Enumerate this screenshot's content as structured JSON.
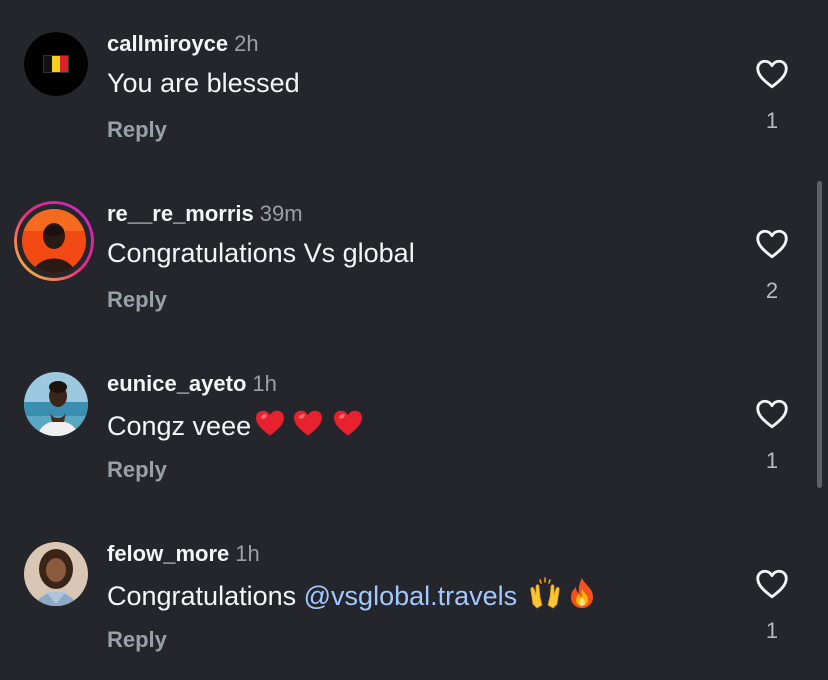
{
  "comments": [
    {
      "username": "callmiroyce",
      "time": "2h",
      "text": "You are blessed",
      "reply_label": "Reply",
      "likes": "1",
      "avatar": "belgium-flag-avatar"
    },
    {
      "username": "re__re_morris",
      "time": "39m",
      "text": "Congratulations Vs global",
      "reply_label": "Reply",
      "likes": "2",
      "avatar": "profile-photo-with-story-ring"
    },
    {
      "username": "eunice_ayeto",
      "time": "1h",
      "text": "Congz veee",
      "emoji": [
        "red-heart",
        "red-heart",
        "red-heart"
      ],
      "reply_label": "Reply",
      "likes": "1",
      "avatar": "profile-photo"
    },
    {
      "username": "felow_more",
      "time": "1h",
      "text": "Congratulations",
      "mention": "@vsglobal.travels",
      "emoji": [
        "raising-hands",
        "fire"
      ],
      "reply_label": "Reply",
      "likes": "1",
      "avatar": "profile-photo"
    }
  ],
  "colors": {
    "background": "#24262b",
    "text": "#f3f5f7",
    "secondary": "#9aa0a8",
    "mention": "#a2c8ff",
    "story_ring": [
      "#f9ce34",
      "#ee2a7b",
      "#6228d7"
    ]
  }
}
